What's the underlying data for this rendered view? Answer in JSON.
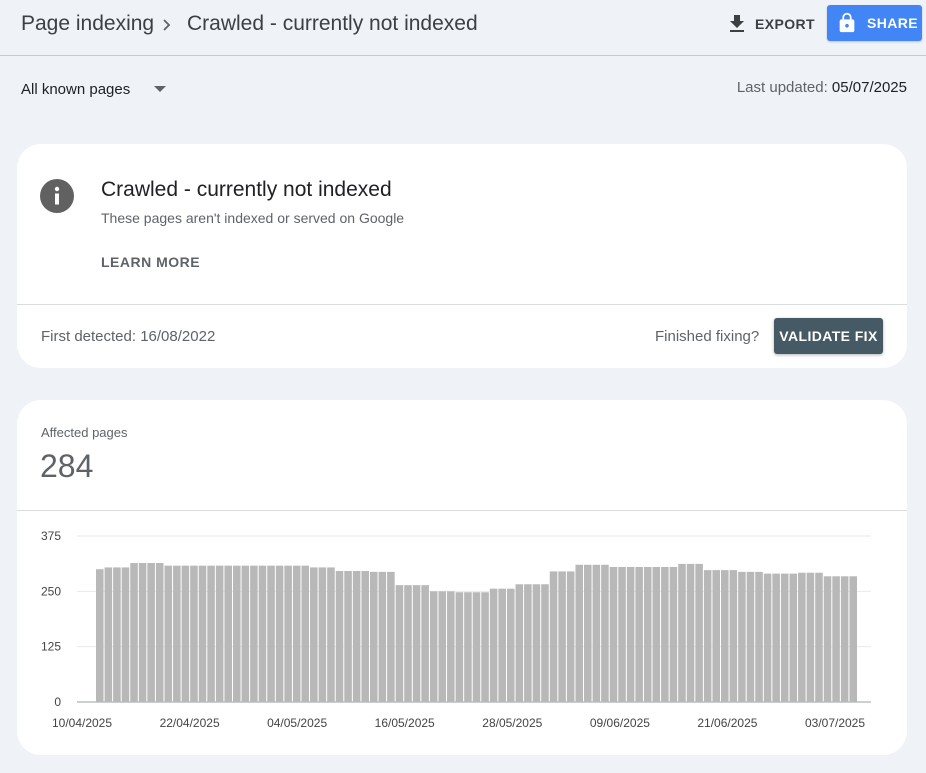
{
  "header": {
    "breadcrumb_root": "Page indexing",
    "breadcrumb_current": "Crawled - currently not indexed",
    "export_label": "EXPORT",
    "share_label": "SHARE",
    "icons": {
      "separator": "chevron-right-icon",
      "export": "download-icon",
      "share": "lock-icon"
    },
    "colors": {
      "share_bg": "#4285f4"
    }
  },
  "filter": {
    "selected": "All known pages",
    "last_updated_label": "Last updated:",
    "last_updated_value": "05/07/2025"
  },
  "issue_card": {
    "title": "Crawled - currently not indexed",
    "description": "These pages aren't indexed or served on Google",
    "learn_more": "LEARN MORE",
    "first_detected": "First detected: 16/08/2022",
    "finished_fixing": "Finished fixing?",
    "validate_fix": "VALIDATE FIX",
    "icon": "info-icon",
    "colors": {
      "validate_bg": "#455a64",
      "info_icon": "#616161"
    }
  },
  "affected_card": {
    "label": "Affected pages",
    "value": "284"
  },
  "chart_data": {
    "type": "bar",
    "ylim": [
      0,
      375
    ],
    "yticks": [
      "375",
      "250",
      "125",
      "0"
    ],
    "xticks": [
      "10/04/2025",
      "22/04/2025",
      "04/05/2025",
      "16/05/2025",
      "28/05/2025",
      "09/06/2025",
      "21/06/2025",
      "03/07/2025"
    ],
    "values": [
      300,
      304,
      304,
      304,
      314,
      314,
      314,
      314,
      308,
      308,
      308,
      308,
      308,
      308,
      308,
      308,
      308,
      308,
      308,
      308,
      308,
      308,
      308,
      308,
      308,
      304,
      304,
      304,
      296,
      296,
      296,
      296,
      294,
      294,
      294,
      264,
      264,
      264,
      264,
      250,
      250,
      250,
      248,
      248,
      248,
      248,
      256,
      256,
      256,
      266,
      266,
      266,
      266,
      295,
      295,
      295,
      310,
      310,
      310,
      310,
      305,
      305,
      305,
      305,
      305,
      305,
      305,
      305,
      312,
      312,
      312,
      298,
      298,
      298,
      298,
      294,
      294,
      294,
      290,
      290,
      290,
      290,
      292,
      292,
      292,
      284,
      284,
      284,
      284
    ],
    "bar_color": "#b8b8b8",
    "grid": true
  }
}
